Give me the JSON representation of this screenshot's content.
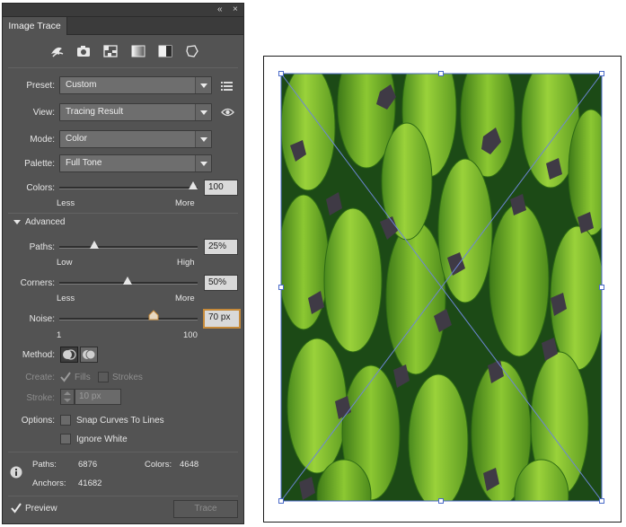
{
  "panel": {
    "title": "Image Trace",
    "controls": {
      "collapse": "«",
      "close": "×"
    },
    "preset": {
      "label": "Preset:",
      "value": "Custom"
    },
    "view": {
      "label": "View:",
      "value": "Tracing Result"
    },
    "mode": {
      "label": "Mode:",
      "value": "Color"
    },
    "palette": {
      "label": "Palette:",
      "value": "Full Tone"
    },
    "colors": {
      "label": "Colors:",
      "value": "100",
      "min_label": "Less",
      "max_label": "More",
      "level": 1.0
    },
    "advanced": {
      "label": "Advanced"
    },
    "paths": {
      "label": "Paths:",
      "value": "25%",
      "min_label": "Low",
      "max_label": "High",
      "level": 0.25
    },
    "corners": {
      "label": "Corners:",
      "value": "50%",
      "min_label": "Less",
      "max_label": "More",
      "level": 0.5
    },
    "noise": {
      "label": "Noise:",
      "value": "70 px",
      "min_label": "1",
      "max_label": "100",
      "level": 0.7
    },
    "method": {
      "label": "Method:"
    },
    "create": {
      "label": "Create:",
      "fills": "Fills",
      "strokes": "Strokes"
    },
    "stroke": {
      "label": "Stroke:",
      "value": "10 px"
    },
    "options": {
      "label": "Options:",
      "snap": "Snap Curves To Lines",
      "ignore_white": "Ignore White"
    },
    "stats": {
      "paths_label": "Paths:",
      "paths_value": "6876",
      "colors_label": "Colors:",
      "colors_value": "4648",
      "anchors_label": "Anchors:",
      "anchors_value": "41682"
    },
    "preview": {
      "label": "Preview",
      "checked": true
    },
    "trace_button": "Trace"
  },
  "icons": [
    "auto-color-icon",
    "high-color-icon",
    "low-color-icon",
    "grayscale-icon",
    "black-white-icon",
    "outline-icon",
    "palette-menu-icon",
    "eye-icon",
    "info-icon",
    "checkmark-icon"
  ],
  "colors": {
    "panel_bg": "#535353",
    "field_bg": "#6e6e6e",
    "selection": "#4b6bc9",
    "noise_highlight": "#c68a3a"
  }
}
